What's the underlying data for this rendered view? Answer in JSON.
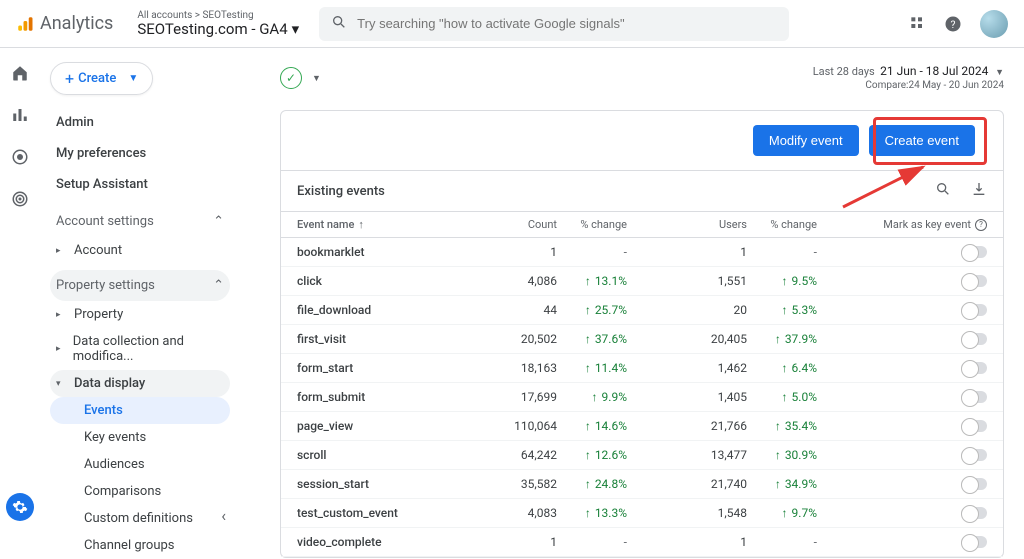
{
  "header": {
    "product_name": "Analytics",
    "breadcrumb": "All accounts > SEOTesting",
    "property": "SEOTesting.com - GA4",
    "search_placeholder": "Try searching \"how to activate Google signals\""
  },
  "sidebar": {
    "create_label": "Create",
    "top_links": [
      "Admin",
      "My preferences",
      "Setup Assistant"
    ],
    "account_section": "Account settings",
    "account_items": [
      "Account"
    ],
    "property_section": "Property settings",
    "property_items": [
      "Property",
      "Data collection and modifica...",
      "Data display"
    ],
    "data_display_children": [
      "Events",
      "Key events",
      "Audiences",
      "Comparisons",
      "Custom definitions",
      "Channel groups"
    ]
  },
  "date_range": {
    "label": "Last 28 days",
    "value": "21 Jun - 18 Jul 2024",
    "compare": "Compare:24 May - 20 Jun 2024"
  },
  "buttons": {
    "modify": "Modify event",
    "create": "Create event"
  },
  "table": {
    "section_title": "Existing events",
    "columns": {
      "name": "Event name",
      "count": "Count",
      "change1": "% change",
      "users": "Users",
      "change2": "% change",
      "mark": "Mark as key event"
    },
    "rows": [
      {
        "name": "bookmarklet",
        "count": "1",
        "chg1": "-",
        "users": "1",
        "chg2": "-"
      },
      {
        "name": "click",
        "count": "4,086",
        "chg1": "13.1%",
        "users": "1,551",
        "chg2": "9.5%"
      },
      {
        "name": "file_download",
        "count": "44",
        "chg1": "25.7%",
        "users": "20",
        "chg2": "5.3%"
      },
      {
        "name": "first_visit",
        "count": "20,502",
        "chg1": "37.6%",
        "users": "20,405",
        "chg2": "37.9%"
      },
      {
        "name": "form_start",
        "count": "18,163",
        "chg1": "11.4%",
        "users": "1,462",
        "chg2": "6.4%"
      },
      {
        "name": "form_submit",
        "count": "17,699",
        "chg1": "9.9%",
        "users": "1,405",
        "chg2": "5.0%"
      },
      {
        "name": "page_view",
        "count": "110,064",
        "chg1": "14.6%",
        "users": "21,766",
        "chg2": "35.4%"
      },
      {
        "name": "scroll",
        "count": "64,242",
        "chg1": "12.6%",
        "users": "13,477",
        "chg2": "30.9%"
      },
      {
        "name": "session_start",
        "count": "35,582",
        "chg1": "24.8%",
        "users": "21,740",
        "chg2": "34.9%"
      },
      {
        "name": "test_custom_event",
        "count": "4,083",
        "chg1": "13.3%",
        "users": "1,548",
        "chg2": "9.7%"
      },
      {
        "name": "video_complete",
        "count": "1",
        "chg1": "-",
        "users": "1",
        "chg2": "-"
      }
    ]
  }
}
